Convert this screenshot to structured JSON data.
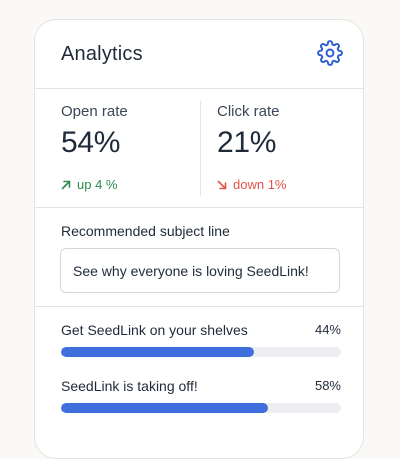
{
  "card": {
    "title": "Analytics",
    "settings_icon": "gear-icon"
  },
  "stats": {
    "open": {
      "label": "Open rate",
      "value": "54%",
      "change": "up 4 %",
      "direction": "up"
    },
    "click": {
      "label": "Click rate",
      "value": "21%",
      "change": "down 1%",
      "direction": "down"
    }
  },
  "subject": {
    "label": "Recommended subject line",
    "value": "See why everyone is loving SeedLink!"
  },
  "variants": [
    {
      "label": "Get SeedLink on your shelves",
      "percent_text": "44%",
      "fill_fraction": 0.69
    },
    {
      "label": "SeedLink is taking off!",
      "percent_text": "58%",
      "fill_fraction": 0.74
    }
  ],
  "colors": {
    "accent": "#3f6fdc",
    "up": "#2f8a4e",
    "down": "#e4514b",
    "gear": "#2d5fd0"
  }
}
